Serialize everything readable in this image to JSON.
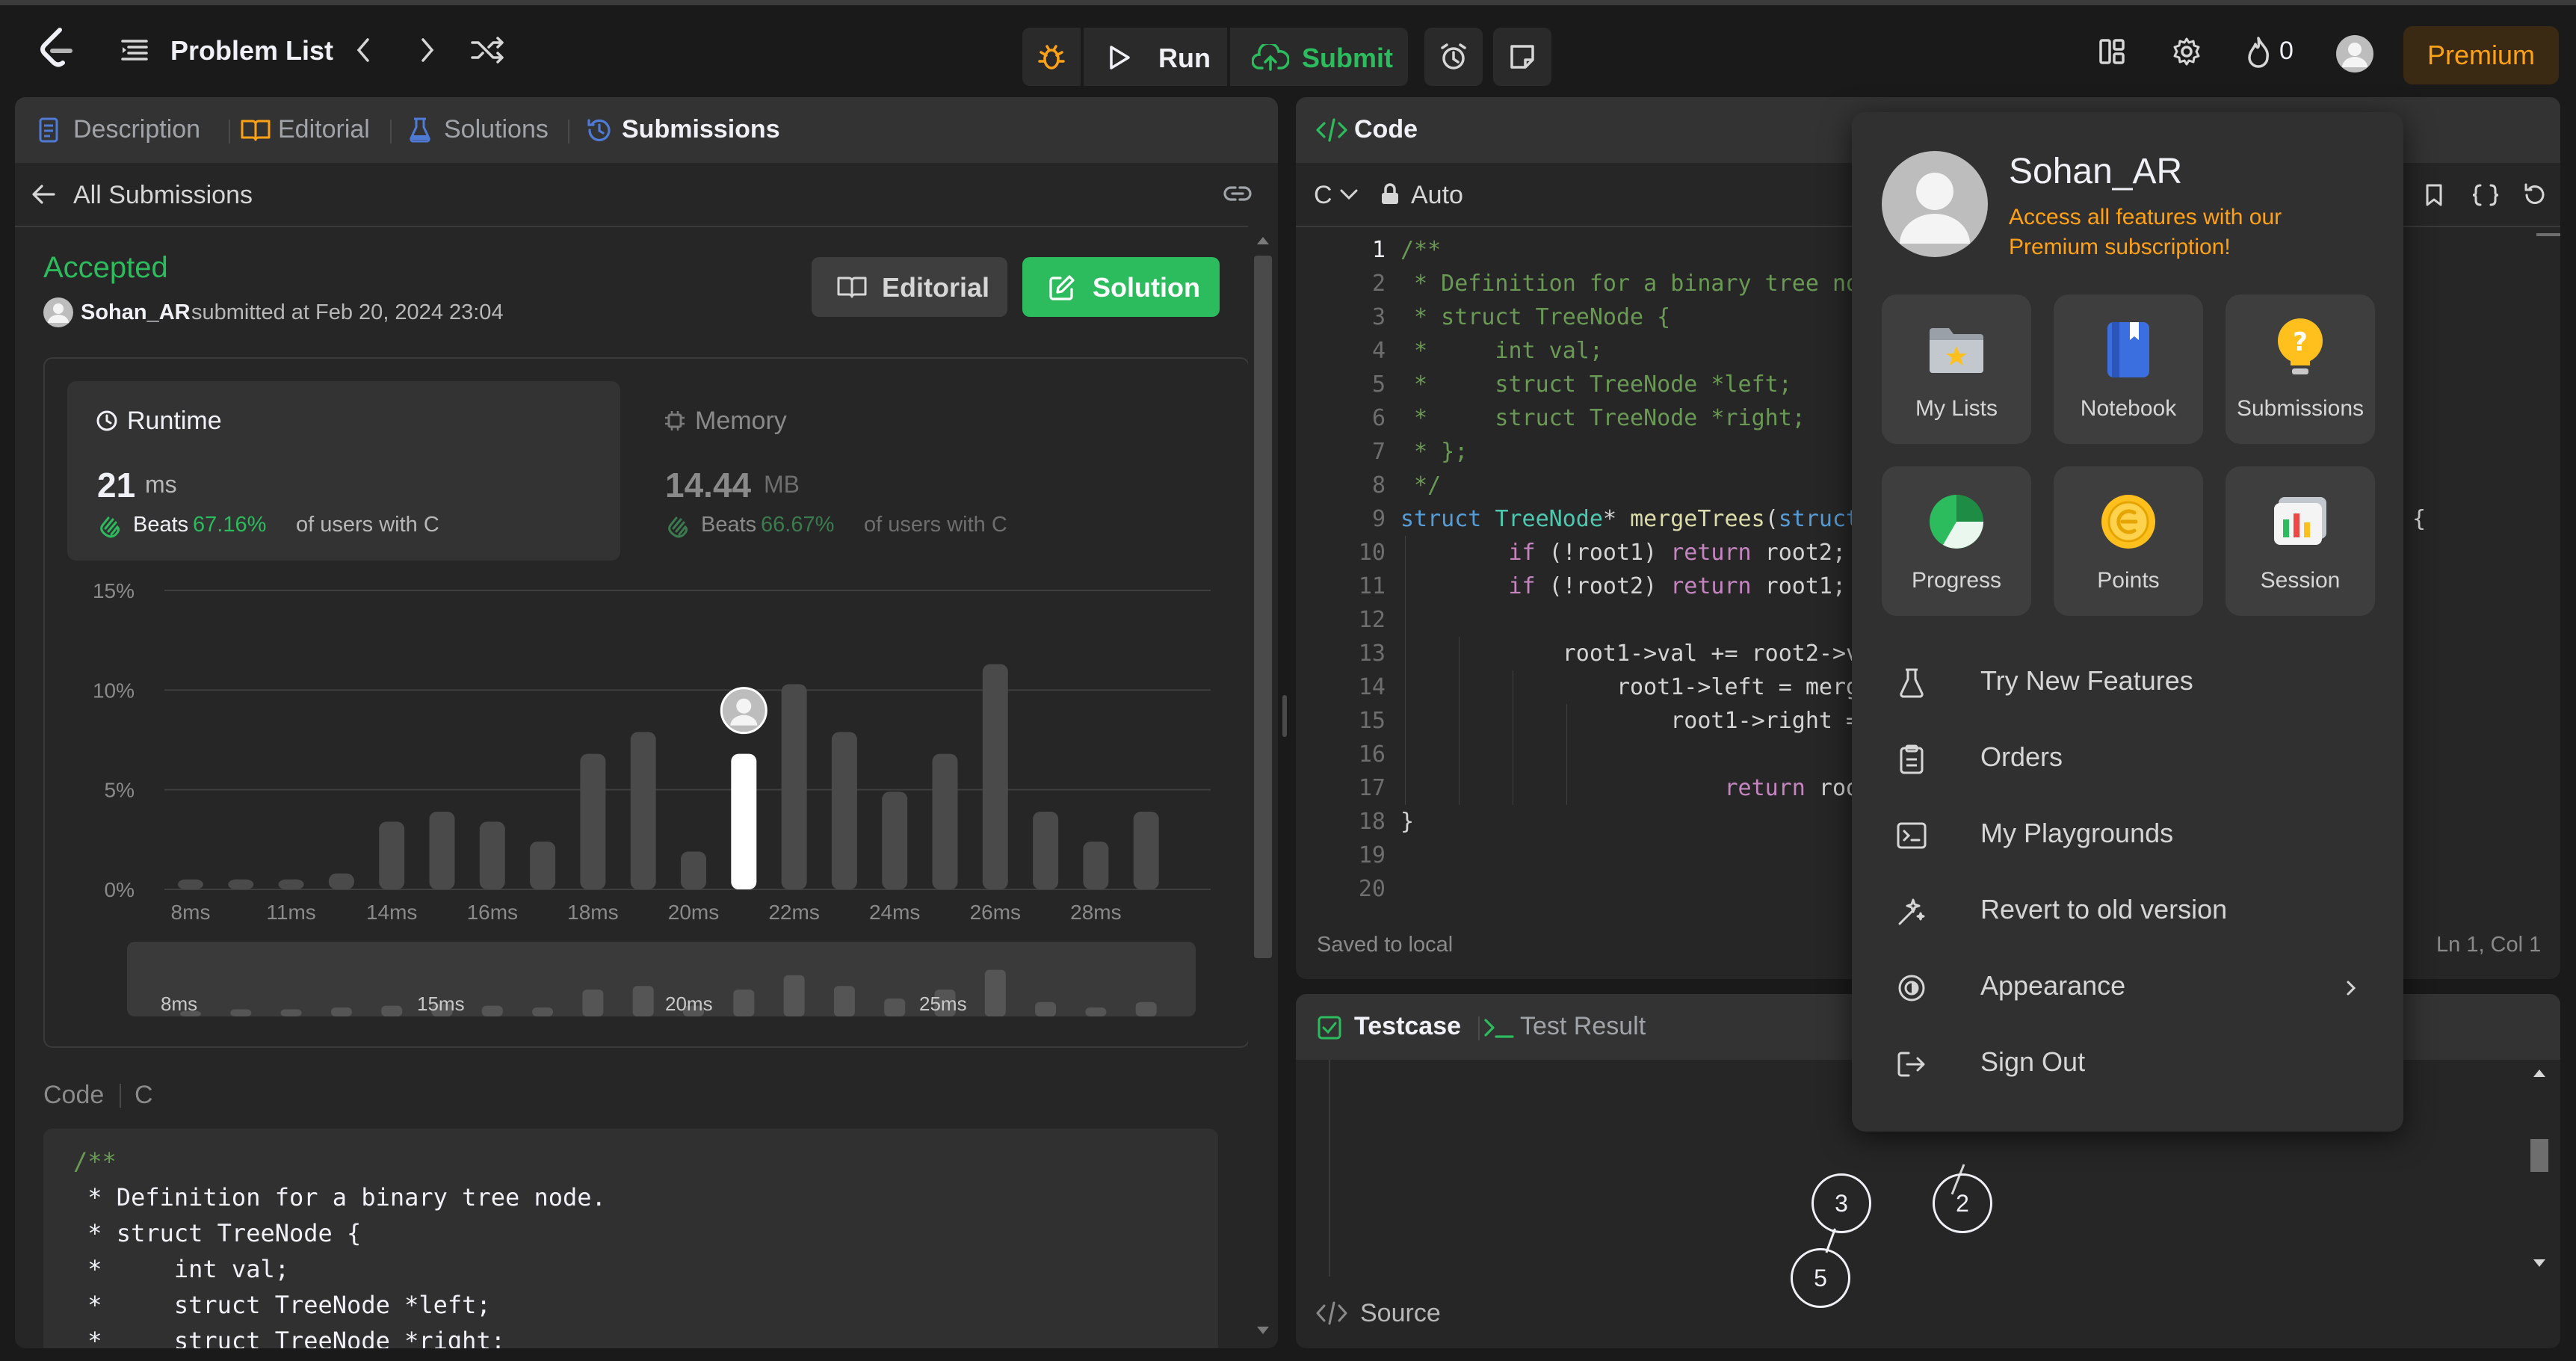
{
  "header": {
    "problem_list": "Problem List",
    "run": "Run",
    "submit": "Submit",
    "fire_count": "0",
    "premium": "Premium"
  },
  "left_tabs": [
    "Description",
    "Editorial",
    "Solutions",
    "Submissions"
  ],
  "submission": {
    "back_label": "All Submissions",
    "status": "Accepted",
    "user": "Sohan_AR",
    "submitted_text": "submitted at Feb 20, 2024 23:04",
    "editorial_btn": "Editorial",
    "solution_btn": "Solution",
    "runtime": {
      "title": "Runtime",
      "value": "21",
      "unit": "ms",
      "beats_label": "Beats",
      "beats_pct": "67.16%",
      "beats_suffix": "of users with C"
    },
    "memory": {
      "title": "Memory",
      "value": "14.44",
      "unit": "MB",
      "beats_label": "Beats",
      "beats_pct": "66.67%",
      "beats_suffix": "of users with C"
    },
    "code_label": "Code",
    "lang_label": "C",
    "code_lines": [
      "/**",
      " * Definition for a binary tree node.",
      " * struct TreeNode {",
      " *     int val;",
      " *     struct TreeNode *left;",
      " *     struct TreeNode *right;"
    ]
  },
  "chart_data": {
    "type": "bar",
    "ylabel_ticks": [
      "15%",
      "10%",
      "5%",
      "0%"
    ],
    "ylim": [
      0,
      15
    ],
    "x_tick_labels": [
      "8ms",
      "11ms",
      "14ms",
      "16ms",
      "18ms",
      "20ms",
      "22ms",
      "24ms",
      "26ms",
      "28ms"
    ],
    "values": [
      0.5,
      0.5,
      0.5,
      0.8,
      3.4,
      3.9,
      3.4,
      2.4,
      6.8,
      7.9,
      1.9,
      6.8,
      10.3,
      7.9,
      4.9,
      6.8,
      11.3,
      3.9,
      2.4,
      3.9
    ],
    "highlight_index": 11,
    "overview_labels": [
      "8ms",
      "15ms",
      "20ms",
      "25ms"
    ],
    "overview_values": [
      0.3,
      0.4,
      0.4,
      0.5,
      0.6,
      0.7,
      0.6,
      0.5,
      1.5,
      1.7,
      0.6,
      1.5,
      2.3,
      1.7,
      1.0,
      1.5,
      2.6,
      0.8,
      0.5,
      0.8
    ]
  },
  "editor": {
    "title": "Code",
    "lang": "C",
    "mode": "Auto",
    "status_left": "Saved to local",
    "status_right": "Ln 1, Col 1",
    "line_numbers": [
      "1",
      "2",
      "3",
      "4",
      "5",
      "6",
      "7",
      "8",
      "9",
      "10",
      "11",
      "12",
      "13",
      "14",
      "15",
      "16",
      "17",
      "18",
      "19",
      "20"
    ],
    "lines": [
      "/**",
      " * Definition for a binary tree no",
      " * struct TreeNode {",
      " *     int val;",
      " *     struct TreeNode *left;",
      " *     struct TreeNode *right;",
      " * };",
      " */",
      "struct TreeNode* mergeTrees(struct",
      "        if (!root1) return root2;",
      "        if (!root2) return root1;",
      "",
      "            root1->val += root2->v",
      "                root1->left = merg",
      "                    root1->right =",
      "",
      "                        return roo",
      "}",
      "",
      ""
    ],
    "line9_tail": "{"
  },
  "testcase": {
    "tab1": "Testcase",
    "tab2": "Test Result",
    "source": "Source",
    "nodes": [
      "3",
      "2",
      "5"
    ]
  },
  "dropdown": {
    "username": "Sohan_AR",
    "promo": [
      "Access all features with our",
      "Premium subscription!"
    ],
    "tiles": [
      "My Lists",
      "Notebook",
      "Submissions",
      "Progress",
      "Points",
      "Session"
    ],
    "menu": [
      "Try New Features",
      "Orders",
      "My Playgrounds",
      "Revert to old version",
      "Appearance",
      "Sign Out"
    ]
  },
  "colors": {
    "accent_green": "#2cbb5d",
    "accepted": "#2cbb5d",
    "premium": "#ffa116",
    "keyword": "#569cd6",
    "comment": "#6a9955"
  }
}
